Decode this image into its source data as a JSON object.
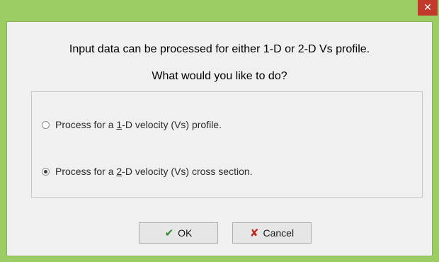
{
  "window": {
    "close_glyph": "✕"
  },
  "message": {
    "line1": "Input data can be processed for either 1-D or 2-D Vs profile.",
    "line2": "What would you like to do?"
  },
  "options": {
    "selected": 2,
    "items": [
      {
        "prefix": "Process for a ",
        "accel": "1",
        "suffix": "-D velocity (Vs) profile."
      },
      {
        "prefix": "Process for a ",
        "accel": "2",
        "suffix": "-D velocity (Vs) cross section."
      }
    ]
  },
  "buttons": {
    "ok_label": "OK",
    "ok_icon": "checkmark-icon",
    "cancel_label": "Cancel",
    "cancel_icon": "x-icon"
  },
  "colors": {
    "frame": "#9ccd65",
    "close": "#c0392b",
    "dialog_bg": "#f0f0f0"
  }
}
